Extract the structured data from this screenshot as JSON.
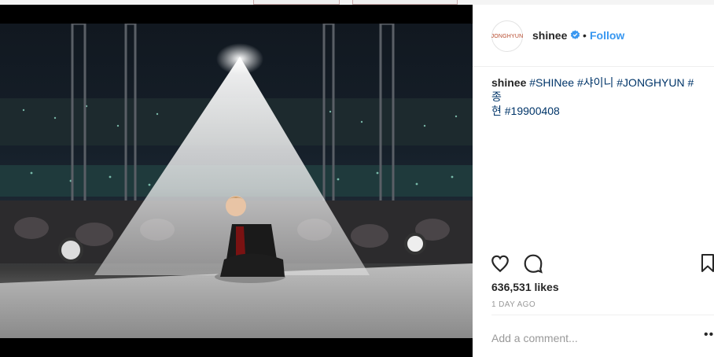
{
  "post": {
    "username": "shinee",
    "avatar_text": "JONGHYUN",
    "dot": "•",
    "follow_label": "Follow",
    "caption": {
      "user": "shinee",
      "hashtags_line1": "#SHINee #샤이니 #JONGHYUN #종",
      "hashtags_line2": "현 #19900408"
    },
    "likes": "636,531 likes",
    "timestamp": "1 DAY AGO",
    "comment_placeholder": "Add a comment...",
    "more_label": "•••"
  },
  "icons": [
    "verified-badge-icon",
    "heart-icon",
    "comment-icon",
    "bookmark-icon",
    "more-options-icon"
  ],
  "colors": {
    "link_blue": "#3897f0",
    "hashtag": "#003569",
    "text": "#262626",
    "muted": "#999999"
  }
}
